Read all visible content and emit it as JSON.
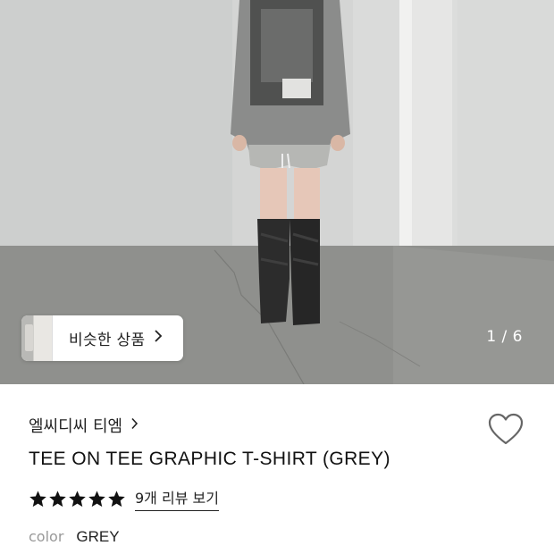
{
  "gallery": {
    "counter": "1 / 6",
    "similar_products_label": "비슷한 상품"
  },
  "product": {
    "brand": "엘씨디씨 티엠",
    "title": "TEE ON TEE GRAPHIC T-SHIRT (GREY)",
    "rating_stars": 5,
    "review_link": "9개 리뷰 보기",
    "color_label": "color",
    "color_value": "GREY"
  },
  "icons": {
    "similar_chevron": "chevron-right-icon",
    "brand_chevron": "chevron-right-icon",
    "wishlist": "heart-outline-icon",
    "rating": "star-filled-icon"
  },
  "colors": {
    "star": "#111111",
    "background": "#ffffff"
  }
}
